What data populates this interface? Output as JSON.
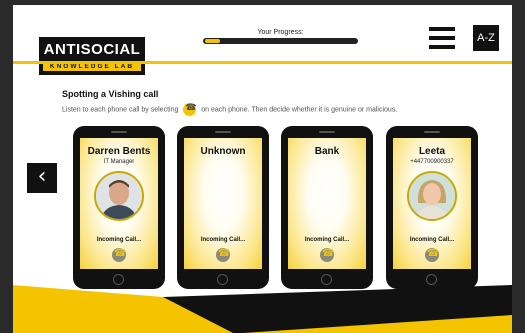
{
  "header": {
    "logo_top": "ANTISOCIAL",
    "logo_bottom": "KNOWLEDGE LAB",
    "progress_label": "Your Progress:",
    "progress_fraction": 0.1,
    "az_label": "A-Z"
  },
  "activity": {
    "title": "Spotting a Vishing call",
    "instructions_before": "Listen to each phone call by selecting",
    "instructions_after": "on each phone. Then decide whether it is genuine or malicious."
  },
  "phones": [
    {
      "name": "Darren Bents",
      "subtitle": "IT Manager",
      "avatar": "male-photo",
      "status": "Incoming Call..."
    },
    {
      "name": "Unknown",
      "subtitle": "",
      "avatar": "none",
      "status": "Incoming Call..."
    },
    {
      "name": "Bank",
      "subtitle": "",
      "avatar": "none",
      "status": "Incoming Call..."
    },
    {
      "name": "Leeta",
      "subtitle": "+447700900337",
      "avatar": "female-photo",
      "status": "Incoming Call..."
    }
  ],
  "nav": {
    "back_icon": "chevron-left-icon"
  },
  "colors": {
    "accent": "#f5c400",
    "dark": "#111111",
    "background": "#2a2a2a"
  }
}
